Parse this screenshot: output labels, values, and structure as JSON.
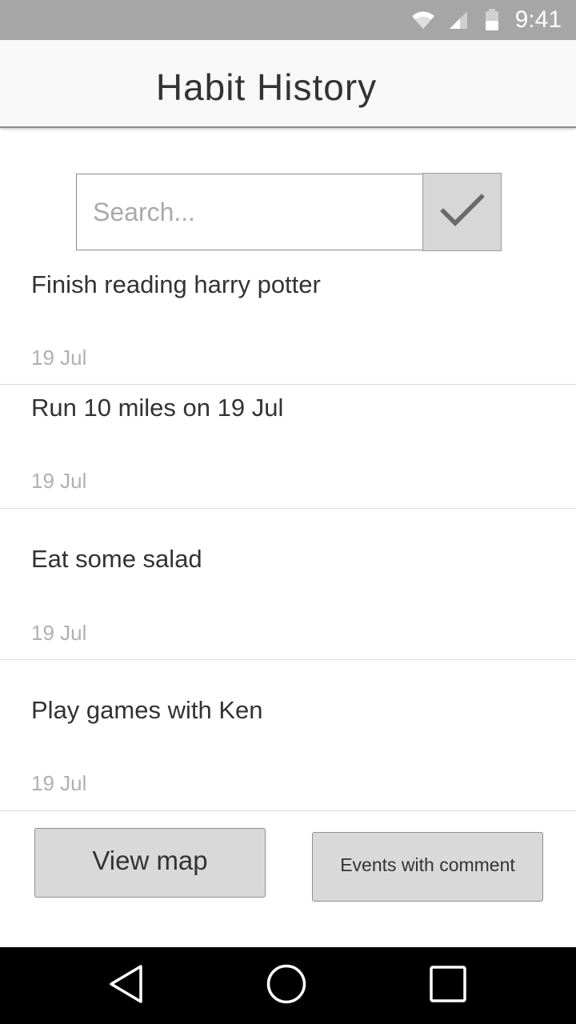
{
  "status_bar": {
    "time": "9:41",
    "icons": [
      "wifi-icon",
      "cell-signal-icon",
      "battery-icon"
    ],
    "background": "#a6a6a6"
  },
  "app_bar": {
    "title": "Habit History"
  },
  "search": {
    "placeholder": "Search...",
    "value": "",
    "submit_icon": "checkmark-icon"
  },
  "habits": [
    {
      "title": "Finish reading harry potter",
      "date": "19 Jul"
    },
    {
      "title": "Run 10 miles on 19 Jul",
      "date": "19 Jul"
    },
    {
      "title": "Eat some salad",
      "date": "19 Jul"
    },
    {
      "title": "Play games with Ken",
      "date": "19 Jul"
    }
  ],
  "actions": {
    "view_map_label": "View map",
    "events_with_comment_label": "Events with comment"
  },
  "nav_bar": {
    "icons": [
      "back-icon",
      "home-icon",
      "recents-icon"
    ]
  }
}
